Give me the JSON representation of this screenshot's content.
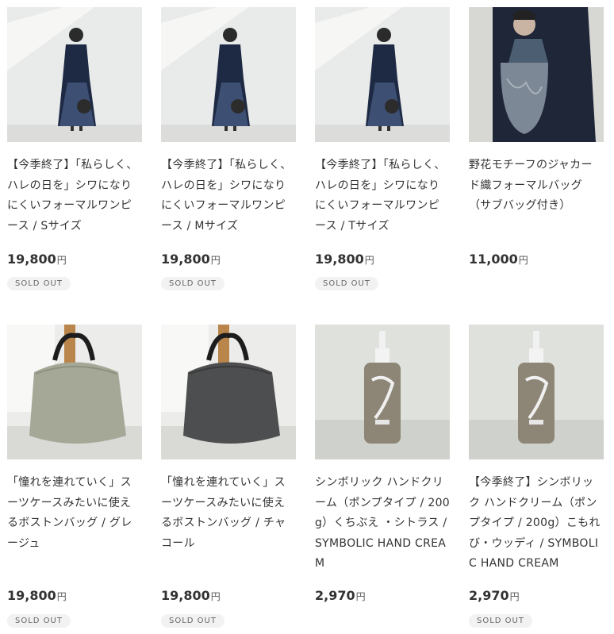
{
  "products": [
    {
      "title": "【今季終了】「私らしく、ハレの日を」シワになりにくいフォーマルワンピース / Sサイズ",
      "price": "19,800",
      "yen": "円",
      "badge": "SOLD OUT",
      "image": "model-dress"
    },
    {
      "title": "【今季終了】「私らしく、ハレの日を」シワになりにくいフォーマルワンピース / Mサイズ",
      "price": "19,800",
      "yen": "円",
      "badge": "SOLD OUT",
      "image": "model-dress"
    },
    {
      "title": "【今季終了】「私らしく、ハレの日を」シワになりにくいフォーマルワンピース / Tサイズ",
      "price": "19,800",
      "yen": "円",
      "badge": "SOLD OUT",
      "image": "model-dress"
    },
    {
      "title": "野花モチーフのジャカード織フォーマルバッグ（サブバッグ付き）",
      "price": "11,000",
      "yen": "円",
      "badge": "",
      "image": "model-bag"
    },
    {
      "title": "「憧れを連れていく」スーツケースみたいに使えるボストンバッグ / グレージュ",
      "price": "19,800",
      "yen": "円",
      "badge": "SOLD OUT",
      "image": "boston-greige"
    },
    {
      "title": "「憧れを連れていく」スーツケースみたいに使えるボストンバッグ / チャコール",
      "price": "19,800",
      "yen": "円",
      "badge": "SOLD OUT",
      "image": "boston-charcoal"
    },
    {
      "title": "シンボリック ハンドクリーム（ポンプタイプ / 200g）くちぶえ ・シトラス / SYMBOLIC HAND CREAM",
      "price": "2,970",
      "yen": "円",
      "badge": "",
      "image": "hand-cream"
    },
    {
      "title": "【今季終了】シンボリック ハンドクリーム（ポンプタイプ / 200g）こもれび・ウッディ / SYMBOLIC HAND CREAM",
      "price": "2,970",
      "yen": "円",
      "badge": "SOLD OUT",
      "image": "hand-cream"
    }
  ]
}
